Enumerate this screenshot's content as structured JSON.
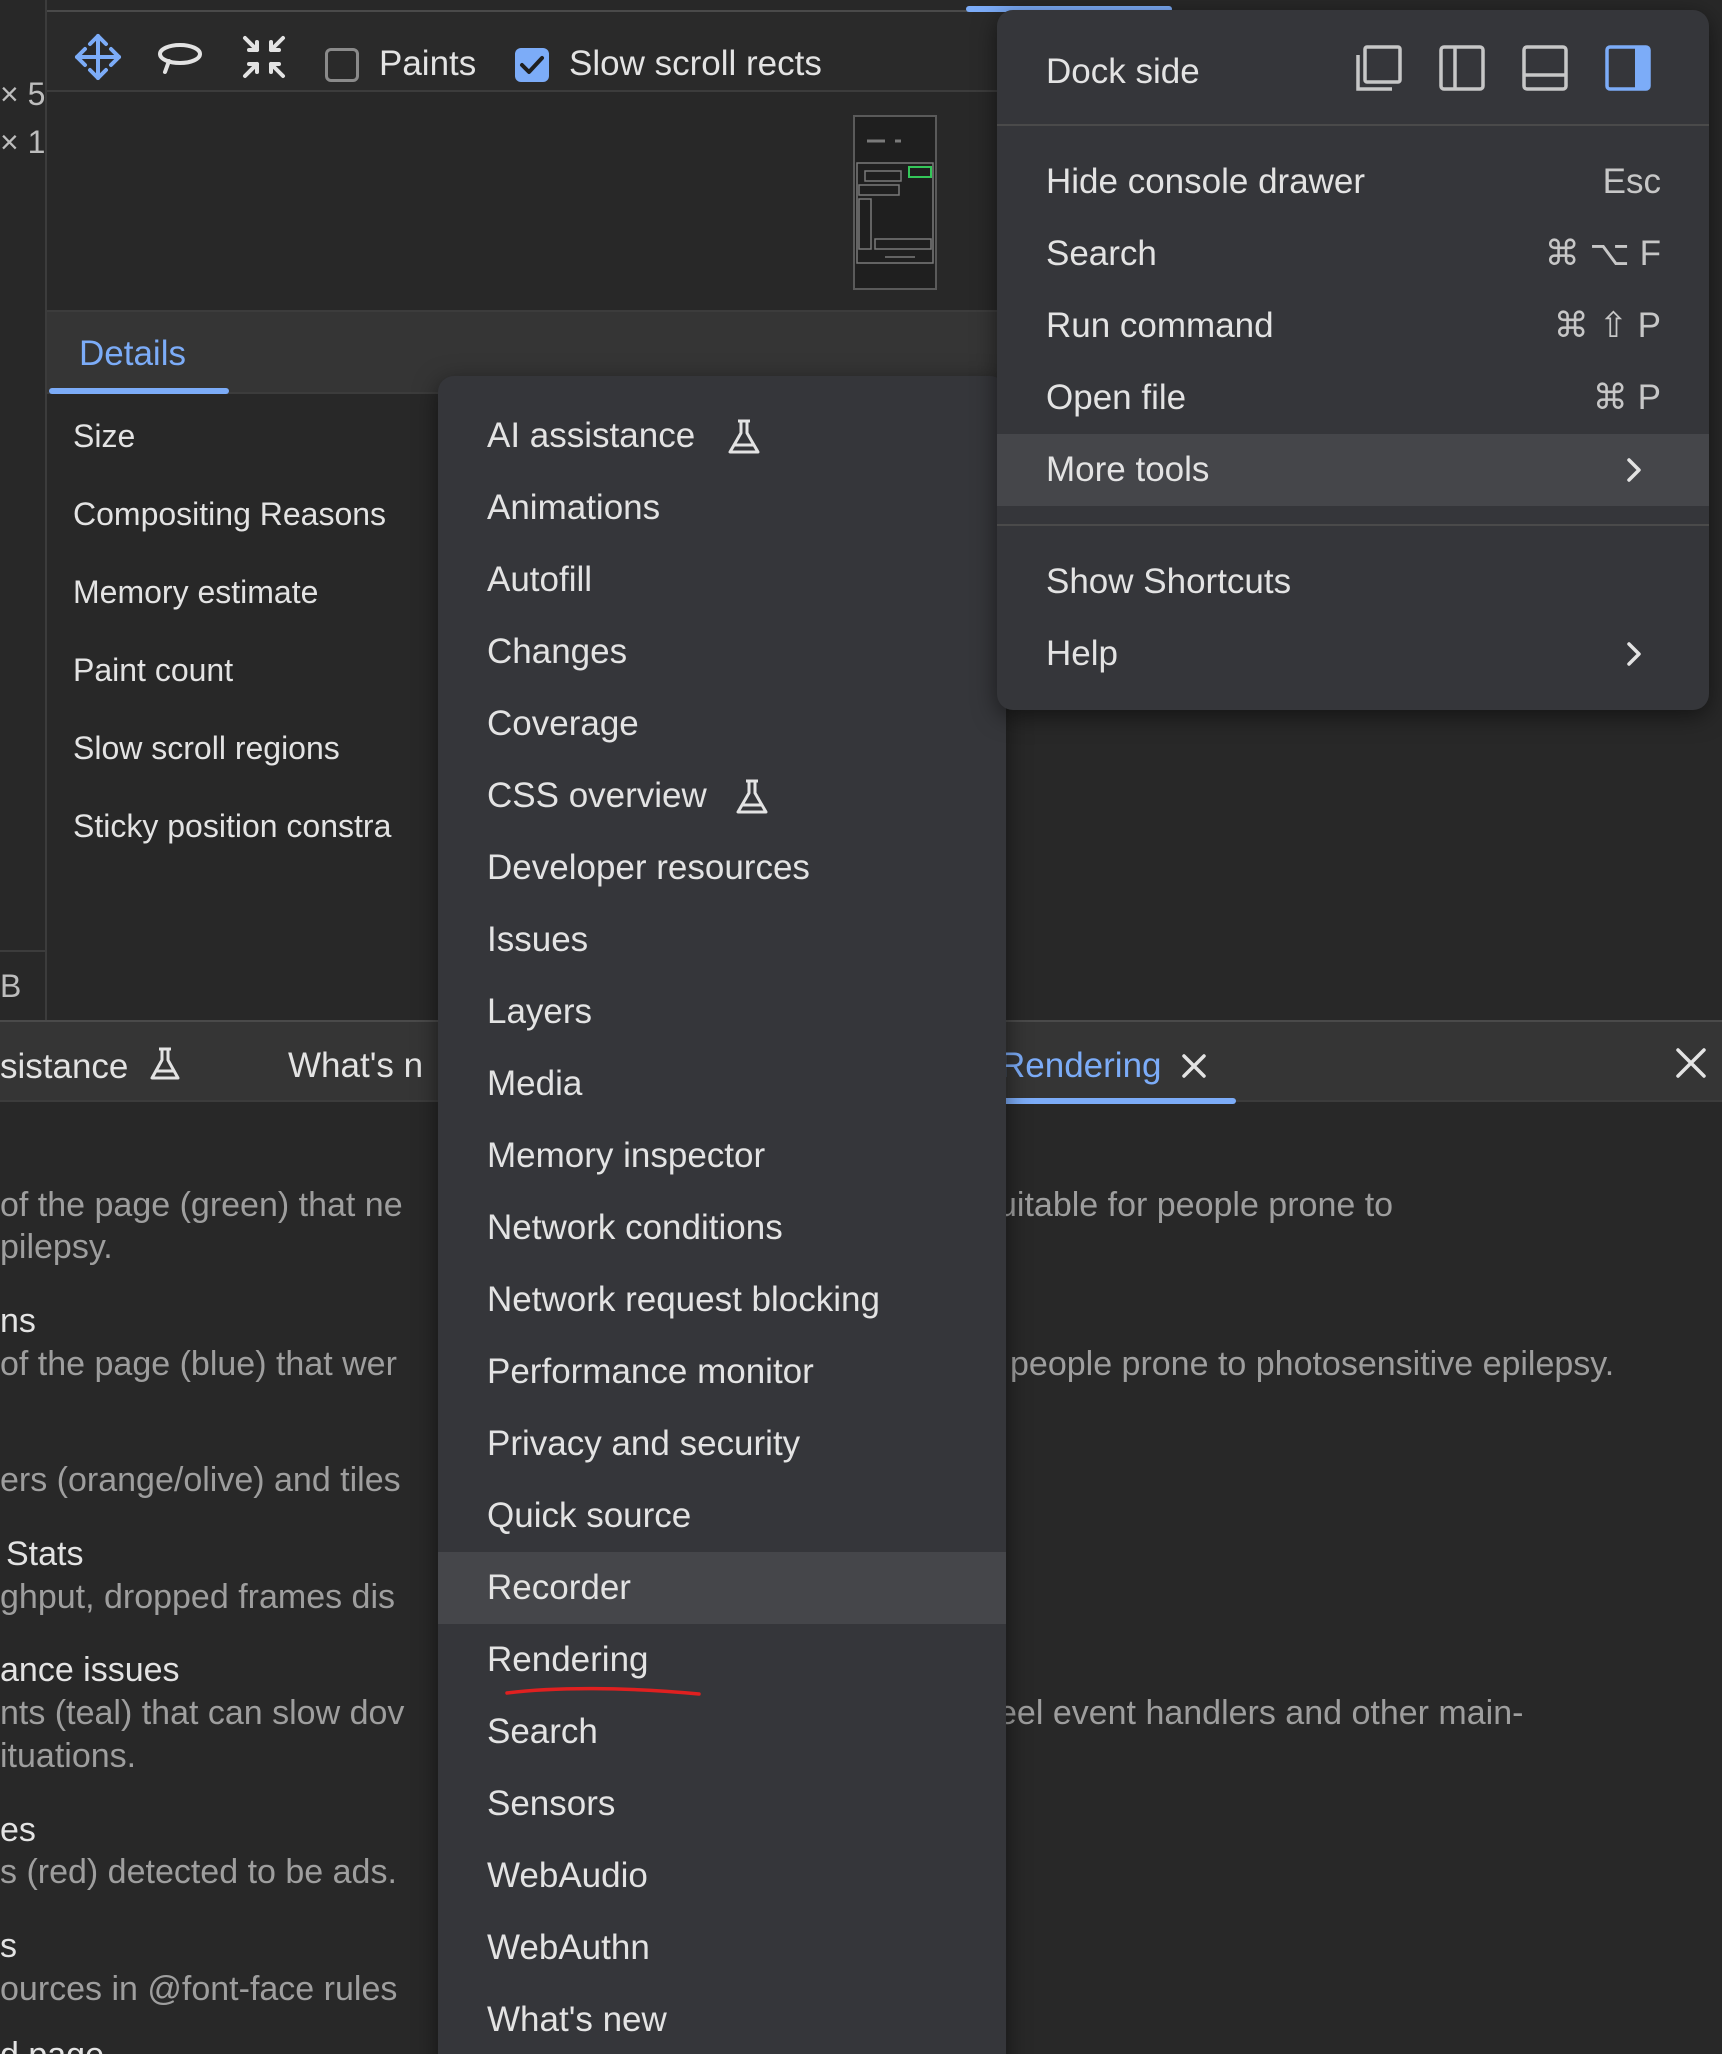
{
  "colors": {
    "accent": "#7cacf8",
    "menu_bg": "#35363a",
    "highlight": "#45464a",
    "panel_bg": "#282828",
    "annotation": "#e02020"
  },
  "left_strip": {
    "line1": "× 5",
    "line2": "× 1",
    "line3": "B"
  },
  "toolbar": {
    "icons": [
      "pan-icon",
      "rotate-icon",
      "reset-view-icon"
    ],
    "paints_label": "Paints",
    "paints_checked": false,
    "slow_scroll_label": "Slow scroll rects",
    "slow_scroll_checked": true
  },
  "details": {
    "tab_label": "Details",
    "rows": [
      "Size",
      "Compositing Reasons",
      "Memory estimate",
      "Paint count",
      "Slow scroll regions",
      "Sticky position constra"
    ]
  },
  "drawer": {
    "tabs": [
      {
        "label": "sistance",
        "icon": "flask-icon"
      },
      {
        "label": "What's n"
      },
      {
        "label": "Rendering",
        "active": true
      }
    ],
    "close_all_icon": "close-icon"
  },
  "rendering_content": {
    "left_fragments": [
      {
        "kind": "text",
        "text": "of the page (green) that ne"
      },
      {
        "kind": "text",
        "text": "pilepsy."
      },
      {
        "kind": "title",
        "text": "ns"
      },
      {
        "kind": "text",
        "text": "of the page (blue) that wer"
      },
      {
        "kind": "text",
        "text": "ers (orange/olive) and tiles"
      },
      {
        "kind": "title",
        "text": "Stats"
      },
      {
        "kind": "text",
        "text": "ghput, dropped frames dis"
      },
      {
        "kind": "title",
        "text": "ance issues"
      },
      {
        "kind": "text",
        "text": "nts (teal) that can slow dov"
      },
      {
        "kind": "text",
        "text": "ituations."
      },
      {
        "kind": "title",
        "text": "es"
      },
      {
        "kind": "text",
        "text": "s (red) detected to be ads."
      },
      {
        "kind": "title",
        "text": "s"
      },
      {
        "kind": "text",
        "text": "ources in @font-face rules"
      },
      {
        "kind": "title",
        "text": "d page"
      }
    ],
    "right_fragments": [
      {
        "text": "uitable for people prone to"
      },
      {
        "text": "people prone to photosensitive epilepsy."
      },
      {
        "text": "eel event handlers and other main-"
      }
    ]
  },
  "more_tools_menu": {
    "items": [
      {
        "label": "AI assistance",
        "icon": "flask-icon"
      },
      {
        "label": "Animations"
      },
      {
        "label": "Autofill"
      },
      {
        "label": "Changes"
      },
      {
        "label": "Coverage"
      },
      {
        "label": "CSS overview",
        "icon": "flask-icon"
      },
      {
        "label": "Developer resources"
      },
      {
        "label": "Issues"
      },
      {
        "label": "Layers"
      },
      {
        "label": "Media"
      },
      {
        "label": "Memory inspector"
      },
      {
        "label": "Network conditions"
      },
      {
        "label": "Network request blocking"
      },
      {
        "label": "Performance monitor"
      },
      {
        "label": "Privacy and security"
      },
      {
        "label": "Quick source"
      },
      {
        "label": "Recorder",
        "highlighted": true
      },
      {
        "label": "Rendering",
        "annotated": true
      },
      {
        "label": "Search"
      },
      {
        "label": "Sensors"
      },
      {
        "label": "WebAudio"
      },
      {
        "label": "WebAuthn"
      },
      {
        "label": "What's new"
      }
    ]
  },
  "main_menu": {
    "dock_side": {
      "label": "Dock side",
      "options": [
        {
          "icon": "undock-icon"
        },
        {
          "icon": "dock-left-icon"
        },
        {
          "icon": "dock-bottom-icon"
        },
        {
          "icon": "dock-right-icon",
          "active": true
        }
      ]
    },
    "items": [
      {
        "label": "Hide console drawer",
        "shortcut": "Esc"
      },
      {
        "label": "Search",
        "shortcut": "⌘ ⌥ F"
      },
      {
        "label": "Run command",
        "shortcut": "⌘ ⇧ P"
      },
      {
        "label": "Open file",
        "shortcut": "⌘ P"
      },
      {
        "label": "More tools",
        "submenu": true,
        "highlighted": true
      },
      {
        "label": "Show Shortcuts"
      },
      {
        "label": "Help",
        "submenu": true
      }
    ]
  }
}
